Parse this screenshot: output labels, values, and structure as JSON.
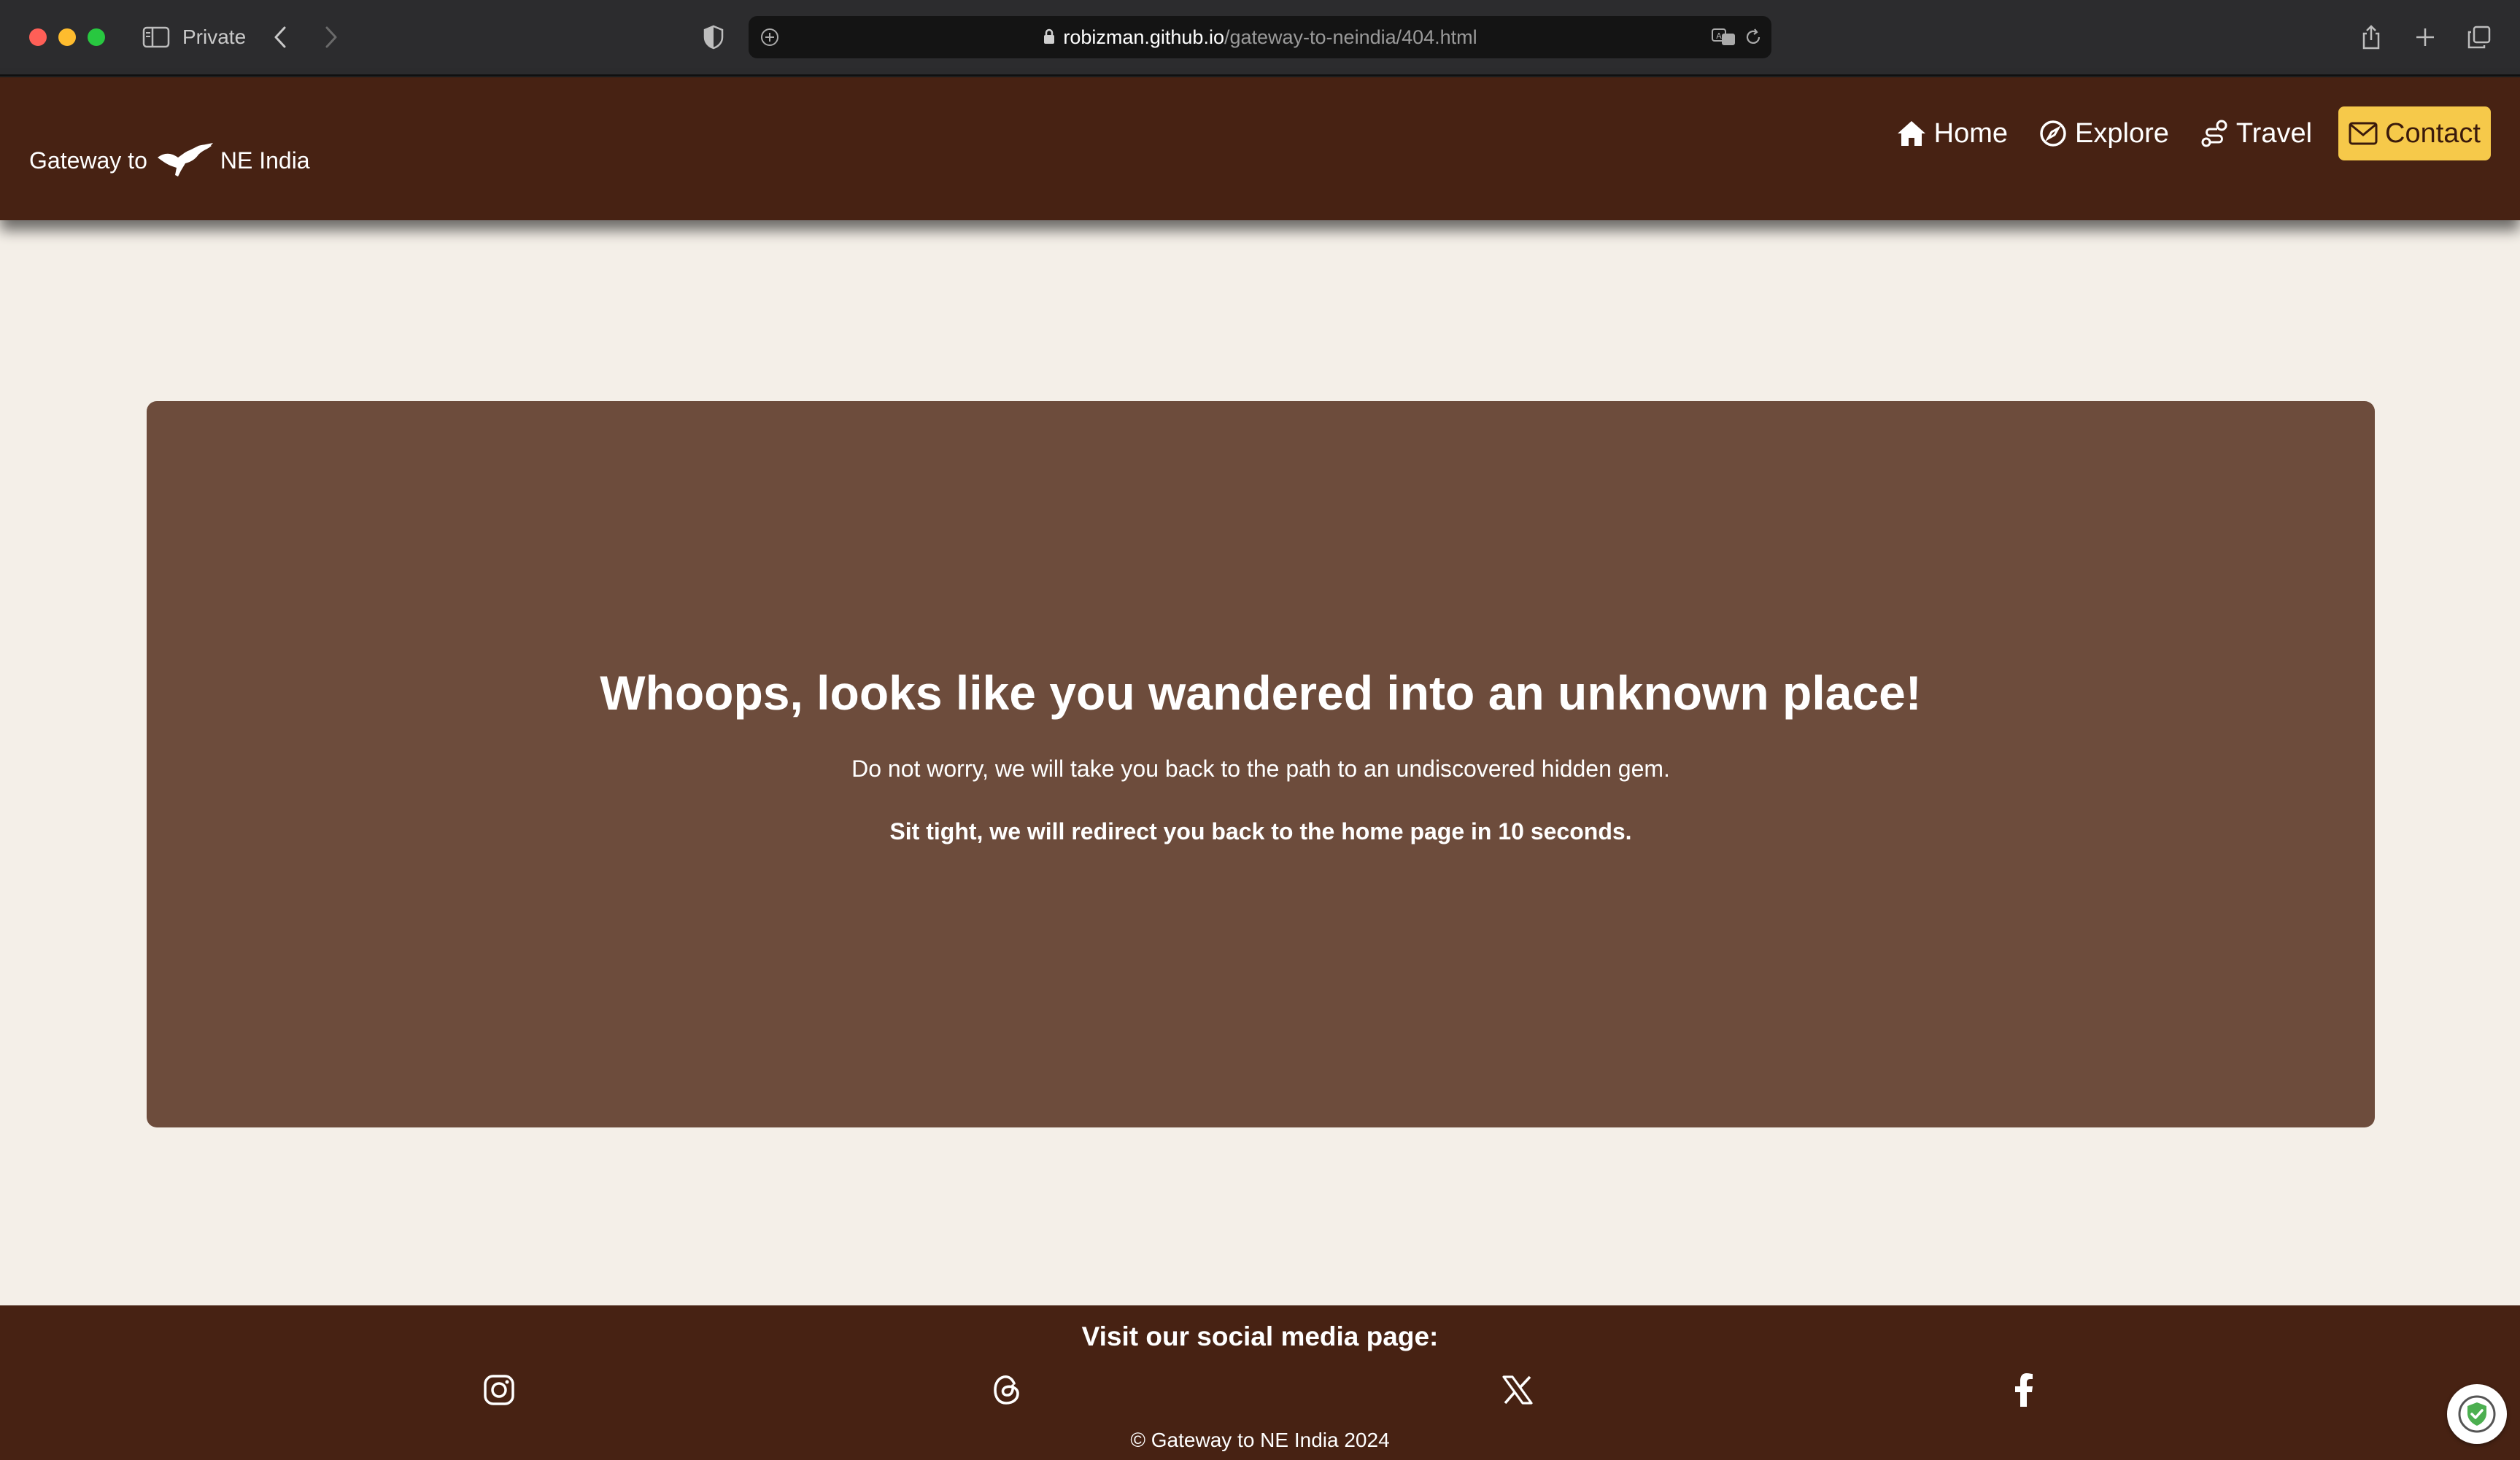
{
  "browser": {
    "private_label": "Private",
    "url_host": "robizman.github.io",
    "url_path": "/gateway-to-neindia/404.html"
  },
  "navbar": {
    "brand_prefix": "Gateway to",
    "brand_suffix": "NE India",
    "links": [
      {
        "label": "Home",
        "icon": "home-icon"
      },
      {
        "label": "Explore",
        "icon": "compass-icon"
      },
      {
        "label": "Travel",
        "icon": "route-icon"
      },
      {
        "label": "Contact",
        "icon": "envelope-icon"
      }
    ]
  },
  "error": {
    "title": "Whoops, looks like you wandered into an unknown place!",
    "message": "Do not worry, we will take you back to the path to an undiscovered hidden gem.",
    "redirect": "Sit tight, we will redirect you back to the home page in 10 seconds."
  },
  "footer": {
    "heading": "Visit our social media page:",
    "socials": [
      "instagram-icon",
      "threads-icon",
      "x-icon",
      "facebook-icon"
    ],
    "copyright": "© Gateway to NE India 2024"
  },
  "colors": {
    "nav_bg": "#472213",
    "card_bg": "#6d4c3c",
    "page_bg": "#f4efe8",
    "contact_bg": "#f6c94a"
  }
}
